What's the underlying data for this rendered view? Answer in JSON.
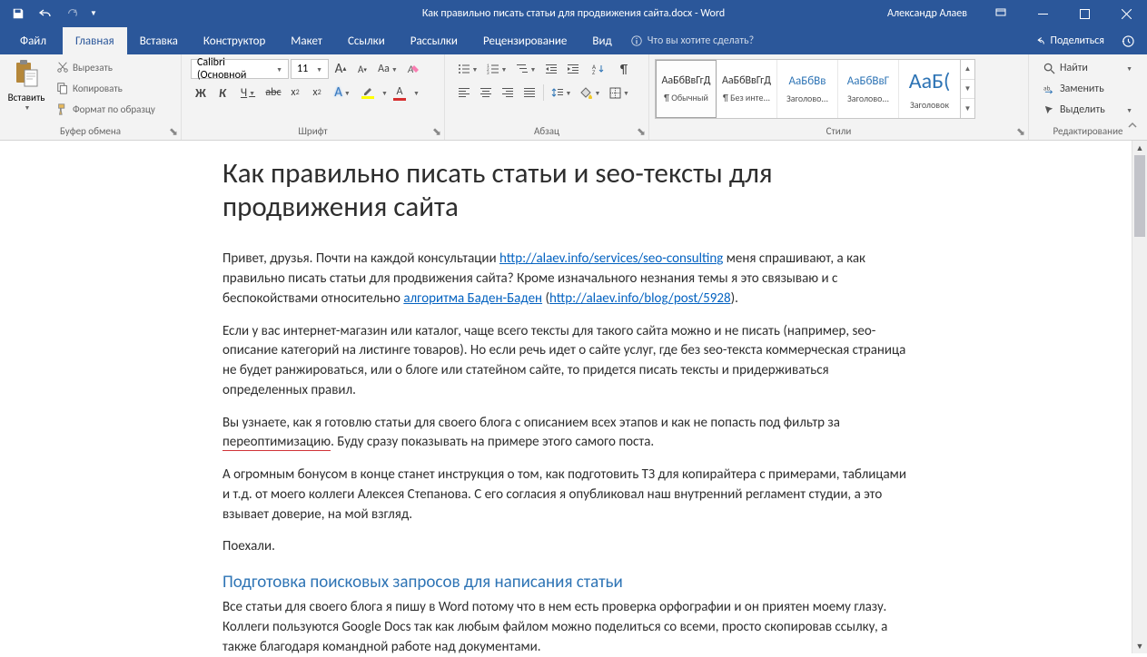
{
  "titlebar": {
    "doc_title": "Как правильно писать статьи для продвижения сайта.docx  -  Word",
    "user": "Александр Алаев"
  },
  "tabs": {
    "file": "Файл",
    "home": "Главная",
    "insert": "Вставка",
    "design": "Конструктор",
    "layout": "Макет",
    "references": "Ссылки",
    "mailings": "Рассылки",
    "review": "Рецензирование",
    "view": "Вид",
    "tell_me": "Что вы хотите сделать?",
    "share": "Поделиться"
  },
  "ribbon": {
    "clipboard": {
      "label": "Буфер обмена",
      "paste": "Вставить",
      "cut": "Вырезать",
      "copy": "Копировать",
      "format_painter": "Формат по образцу"
    },
    "font": {
      "label": "Шрифт",
      "name": "Calibri (Основной",
      "size": "11",
      "bold": "Ж",
      "italic": "К",
      "underline": "Ч",
      "strike": "abc",
      "sub": "x",
      "sup": "x",
      "case": "Aa",
      "grow": "A",
      "shrink": "A"
    },
    "paragraph": {
      "label": "Абзац"
    },
    "styles": {
      "label": "Стили",
      "items": [
        {
          "preview": "АаБбВвГгД",
          "name": "¶ Обычный",
          "cls": ""
        },
        {
          "preview": "АаБбВвГгД",
          "name": "¶ Без инте...",
          "cls": ""
        },
        {
          "preview": "АаБбВв",
          "name": "Заголово...",
          "cls": "h"
        },
        {
          "preview": "АаБбВвГ",
          "name": "Заголово...",
          "cls": "h"
        },
        {
          "preview": "АаБ(",
          "name": "Заголовок",
          "cls": "big"
        }
      ]
    },
    "editing": {
      "label": "Редактирование",
      "find": "Найти",
      "replace": "Заменить",
      "select": "Выделить"
    }
  },
  "document": {
    "title": "Как правильно писать статьи и seo-тексты для продвижения сайта",
    "p1_a": "Привет, друзья. Почти на каждой консультации ",
    "p1_link1": "http://alaev.info/services/seo-consulting",
    "p1_b": " меня спрашивают, а как правильно писать статьи для продвижения сайта? Кроме изначального незнания темы я это связываю и с беспокойствами относительно ",
    "p1_link2": "алгоритма Баден-Баден",
    "p1_c": " (",
    "p1_link3": "http://alaev.info/blog/post/5928",
    "p1_d": ").",
    "p2": "Если у вас интернет-магазин или каталог, чаще всего тексты для такого сайта можно и не писать (например, seo-описание категорий на листинге товаров). Но если речь идет о сайте услуг, где без seo-текста коммерческая страница не будет ранжироваться, или о блоге или статейном сайте, то придется писать тексты и придерживаться определенных правил.",
    "p3_a": "Вы узнаете, как я готовлю статьи для своего блога с описанием всех этапов и как не попасть под фильтр за ",
    "p3_sq": "переоптимизацию",
    "p3_b": ". Буду сразу показывать на примере этого самого поста.",
    "p4": "А огромным бонусом в конце станет инструкция о том, как подготовить ТЗ для копирайтера с примерами, таблицами и т.д. от моего коллеги Алексея Степанова. С его согласия я опубликовал наш внутренний регламент студии, а это взывает доверие, на мой взгляд.",
    "p5": "Поехали.",
    "h2": "Подготовка поисковых запросов для написания статьи",
    "p6": "Все статьи для своего блога я пишу в Word потому что в нем есть проверка орфографии и он приятен моему глазу. Коллеги пользуются Google Docs так как любым файлом можно поделиться со всеми, просто скопировав ссылку, а также благодаря командной работе над документами."
  }
}
